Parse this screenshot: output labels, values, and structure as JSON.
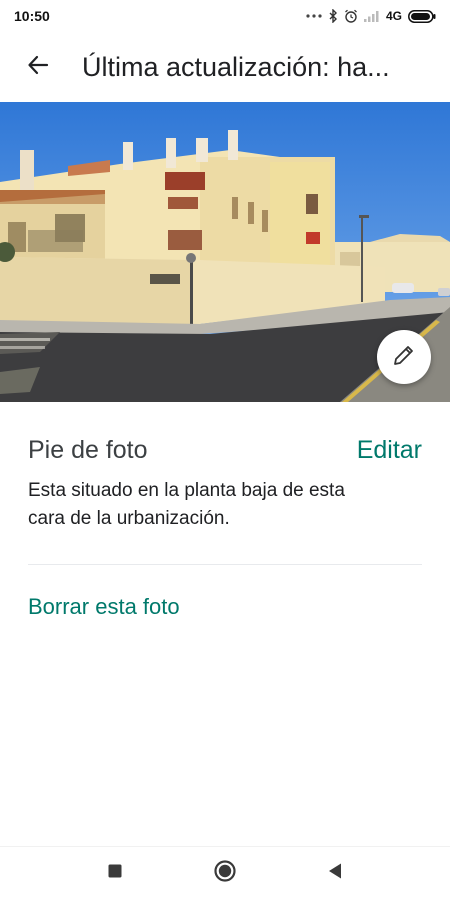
{
  "status_bar": {
    "time": "10:50",
    "network_label": "4G",
    "icons": [
      "more-dots-icon",
      "bluetooth-icon",
      "alarm-icon",
      "signal-icon",
      "battery-icon"
    ]
  },
  "app_bar": {
    "title": "Última actualización: ha...",
    "back_icon": "arrow-back-icon"
  },
  "photo": {
    "edit_icon": "pencil-icon"
  },
  "caption": {
    "title": "Pie de foto",
    "edit_label": "Editar",
    "text": "Esta situado en la planta baja de esta cara de la urbanización."
  },
  "actions": {
    "delete_label": "Borrar esta foto"
  },
  "nav_bar": {
    "buttons": [
      "recents-square-icon",
      "home-circle-icon",
      "back-triangle-icon"
    ]
  },
  "colors": {
    "accent": "#00796b",
    "text_primary": "#202124",
    "divider": "#e8eaed"
  }
}
